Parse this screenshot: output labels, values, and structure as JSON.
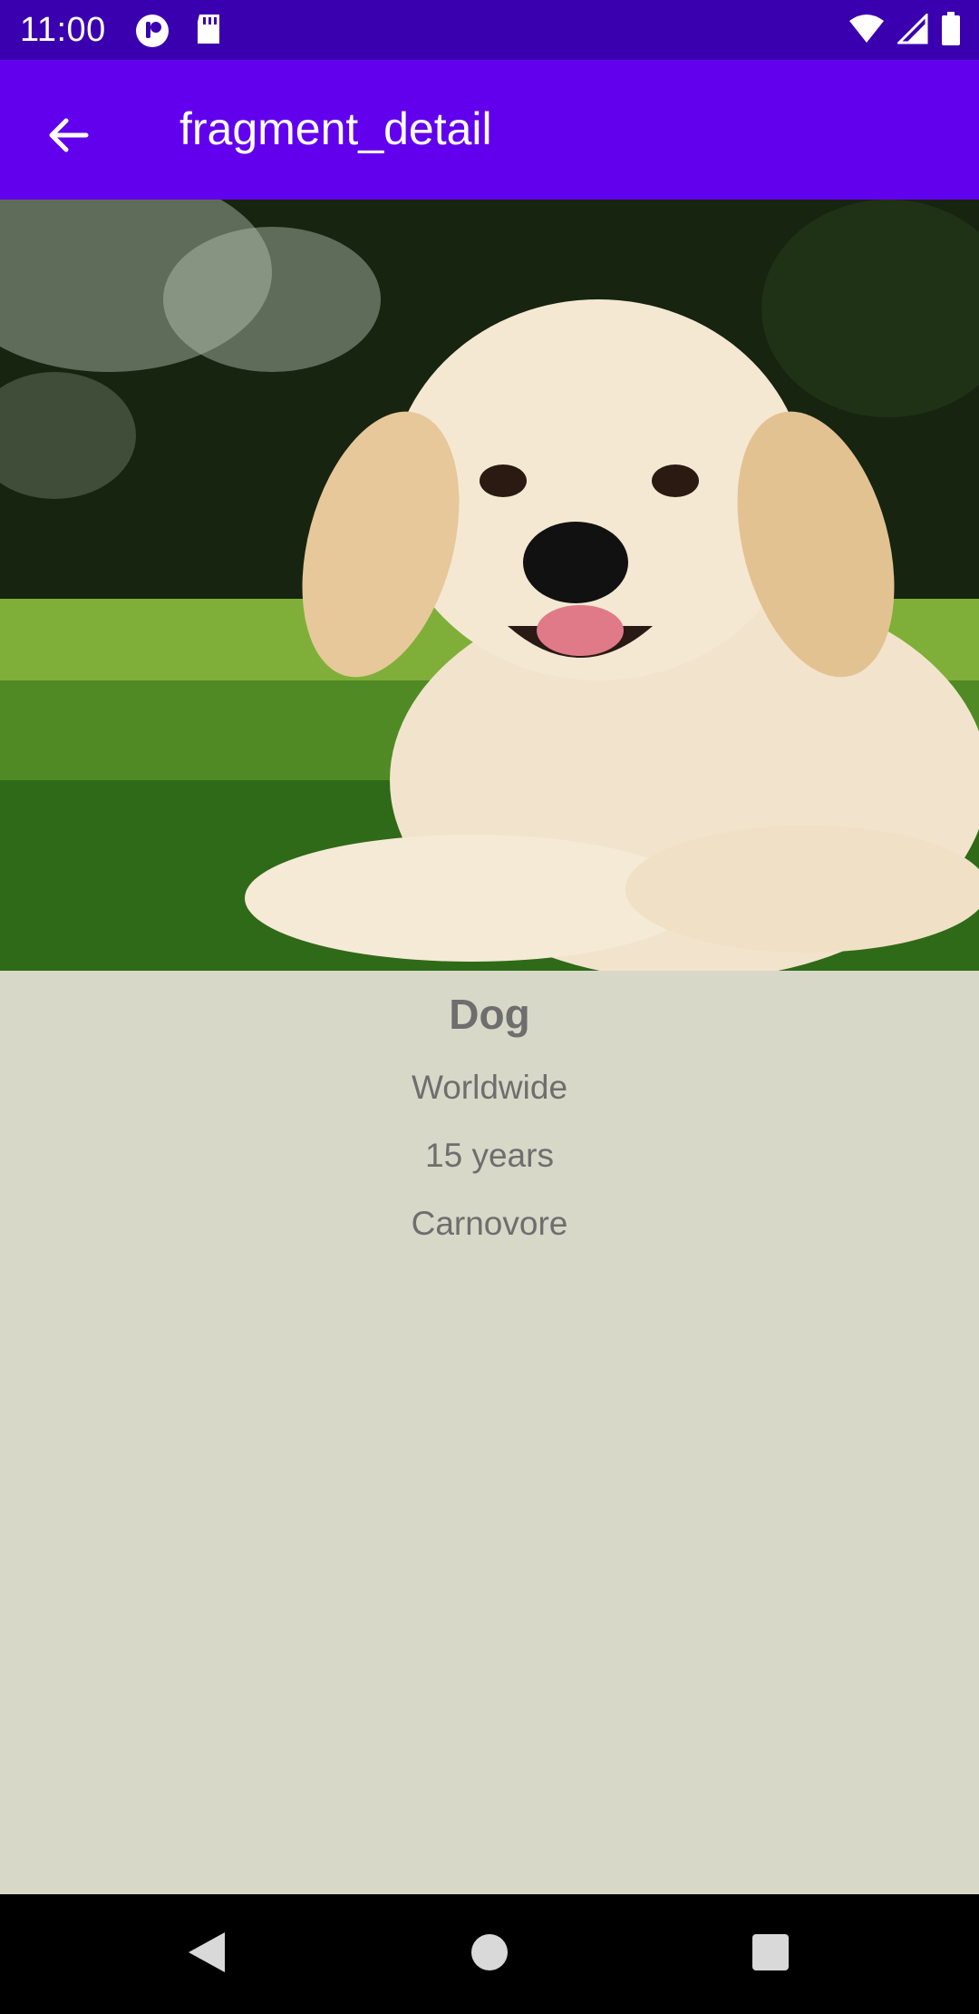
{
  "status_bar": {
    "time": "11:00",
    "icons": [
      "notification-icon",
      "sd-card-icon",
      "wifi-icon",
      "signal-icon",
      "battery-icon"
    ]
  },
  "app_bar": {
    "title": "fragment_detail",
    "back_icon": "arrow-back-icon",
    "color": "#6200ee"
  },
  "hero_image": {
    "description_icon": "dog-photo"
  },
  "animal": {
    "name": "Dog",
    "location": "Worldwide",
    "lifespan": "15 years",
    "diet": "Carnovore"
  },
  "nav_bar": {
    "icons": [
      "nav-back-icon",
      "nav-home-icon",
      "nav-recents-icon"
    ]
  }
}
